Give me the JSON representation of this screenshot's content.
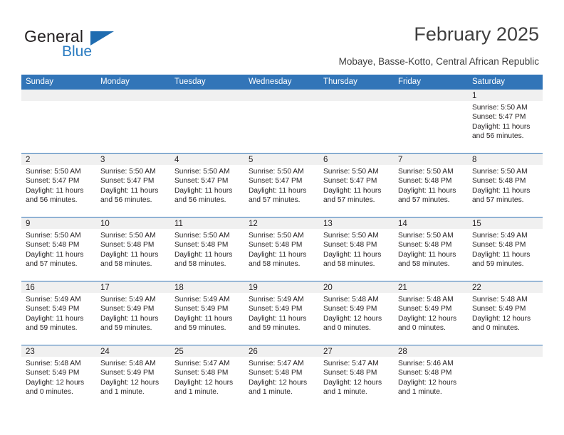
{
  "brand": {
    "name_top": "General",
    "name_bottom": "Blue",
    "accent_color": "#2b7cc1"
  },
  "header": {
    "title": "February 2025",
    "subtitle": "Mobaye, Basse-Kotto, Central African Republic",
    "header_color": "#3275b8"
  },
  "calendar": {
    "weekday_headers": [
      "Sunday",
      "Monday",
      "Tuesday",
      "Wednesday",
      "Thursday",
      "Friday",
      "Saturday"
    ],
    "weeks": [
      [
        {
          "day": "",
          "empty": true
        },
        {
          "day": "",
          "empty": true
        },
        {
          "day": "",
          "empty": true
        },
        {
          "day": "",
          "empty": true
        },
        {
          "day": "",
          "empty": true
        },
        {
          "day": "",
          "empty": true
        },
        {
          "day": "1",
          "sunrise": "Sunrise: 5:50 AM",
          "sunset": "Sunset: 5:47 PM",
          "daylight": "Daylight: 11 hours and 56 minutes."
        }
      ],
      [
        {
          "day": "2",
          "sunrise": "Sunrise: 5:50 AM",
          "sunset": "Sunset: 5:47 PM",
          "daylight": "Daylight: 11 hours and 56 minutes."
        },
        {
          "day": "3",
          "sunrise": "Sunrise: 5:50 AM",
          "sunset": "Sunset: 5:47 PM",
          "daylight": "Daylight: 11 hours and 56 minutes."
        },
        {
          "day": "4",
          "sunrise": "Sunrise: 5:50 AM",
          "sunset": "Sunset: 5:47 PM",
          "daylight": "Daylight: 11 hours and 56 minutes."
        },
        {
          "day": "5",
          "sunrise": "Sunrise: 5:50 AM",
          "sunset": "Sunset: 5:47 PM",
          "daylight": "Daylight: 11 hours and 57 minutes."
        },
        {
          "day": "6",
          "sunrise": "Sunrise: 5:50 AM",
          "sunset": "Sunset: 5:47 PM",
          "daylight": "Daylight: 11 hours and 57 minutes."
        },
        {
          "day": "7",
          "sunrise": "Sunrise: 5:50 AM",
          "sunset": "Sunset: 5:48 PM",
          "daylight": "Daylight: 11 hours and 57 minutes."
        },
        {
          "day": "8",
          "sunrise": "Sunrise: 5:50 AM",
          "sunset": "Sunset: 5:48 PM",
          "daylight": "Daylight: 11 hours and 57 minutes."
        }
      ],
      [
        {
          "day": "9",
          "sunrise": "Sunrise: 5:50 AM",
          "sunset": "Sunset: 5:48 PM",
          "daylight": "Daylight: 11 hours and 57 minutes."
        },
        {
          "day": "10",
          "sunrise": "Sunrise: 5:50 AM",
          "sunset": "Sunset: 5:48 PM",
          "daylight": "Daylight: 11 hours and 58 minutes."
        },
        {
          "day": "11",
          "sunrise": "Sunrise: 5:50 AM",
          "sunset": "Sunset: 5:48 PM",
          "daylight": "Daylight: 11 hours and 58 minutes."
        },
        {
          "day": "12",
          "sunrise": "Sunrise: 5:50 AM",
          "sunset": "Sunset: 5:48 PM",
          "daylight": "Daylight: 11 hours and 58 minutes."
        },
        {
          "day": "13",
          "sunrise": "Sunrise: 5:50 AM",
          "sunset": "Sunset: 5:48 PM",
          "daylight": "Daylight: 11 hours and 58 minutes."
        },
        {
          "day": "14",
          "sunrise": "Sunrise: 5:50 AM",
          "sunset": "Sunset: 5:48 PM",
          "daylight": "Daylight: 11 hours and 58 minutes."
        },
        {
          "day": "15",
          "sunrise": "Sunrise: 5:49 AM",
          "sunset": "Sunset: 5:48 PM",
          "daylight": "Daylight: 11 hours and 59 minutes."
        }
      ],
      [
        {
          "day": "16",
          "sunrise": "Sunrise: 5:49 AM",
          "sunset": "Sunset: 5:49 PM",
          "daylight": "Daylight: 11 hours and 59 minutes."
        },
        {
          "day": "17",
          "sunrise": "Sunrise: 5:49 AM",
          "sunset": "Sunset: 5:49 PM",
          "daylight": "Daylight: 11 hours and 59 minutes."
        },
        {
          "day": "18",
          "sunrise": "Sunrise: 5:49 AM",
          "sunset": "Sunset: 5:49 PM",
          "daylight": "Daylight: 11 hours and 59 minutes."
        },
        {
          "day": "19",
          "sunrise": "Sunrise: 5:49 AM",
          "sunset": "Sunset: 5:49 PM",
          "daylight": "Daylight: 11 hours and 59 minutes."
        },
        {
          "day": "20",
          "sunrise": "Sunrise: 5:48 AM",
          "sunset": "Sunset: 5:49 PM",
          "daylight": "Daylight: 12 hours and 0 minutes."
        },
        {
          "day": "21",
          "sunrise": "Sunrise: 5:48 AM",
          "sunset": "Sunset: 5:49 PM",
          "daylight": "Daylight: 12 hours and 0 minutes."
        },
        {
          "day": "22",
          "sunrise": "Sunrise: 5:48 AM",
          "sunset": "Sunset: 5:49 PM",
          "daylight": "Daylight: 12 hours and 0 minutes."
        }
      ],
      [
        {
          "day": "23",
          "sunrise": "Sunrise: 5:48 AM",
          "sunset": "Sunset: 5:49 PM",
          "daylight": "Daylight: 12 hours and 0 minutes."
        },
        {
          "day": "24",
          "sunrise": "Sunrise: 5:48 AM",
          "sunset": "Sunset: 5:49 PM",
          "daylight": "Daylight: 12 hours and 1 minute."
        },
        {
          "day": "25",
          "sunrise": "Sunrise: 5:47 AM",
          "sunset": "Sunset: 5:48 PM",
          "daylight": "Daylight: 12 hours and 1 minute."
        },
        {
          "day": "26",
          "sunrise": "Sunrise: 5:47 AM",
          "sunset": "Sunset: 5:48 PM",
          "daylight": "Daylight: 12 hours and 1 minute."
        },
        {
          "day": "27",
          "sunrise": "Sunrise: 5:47 AM",
          "sunset": "Sunset: 5:48 PM",
          "daylight": "Daylight: 12 hours and 1 minute."
        },
        {
          "day": "28",
          "sunrise": "Sunrise: 5:46 AM",
          "sunset": "Sunset: 5:48 PM",
          "daylight": "Daylight: 12 hours and 1 minute."
        },
        {
          "day": "",
          "empty": true
        }
      ]
    ]
  }
}
